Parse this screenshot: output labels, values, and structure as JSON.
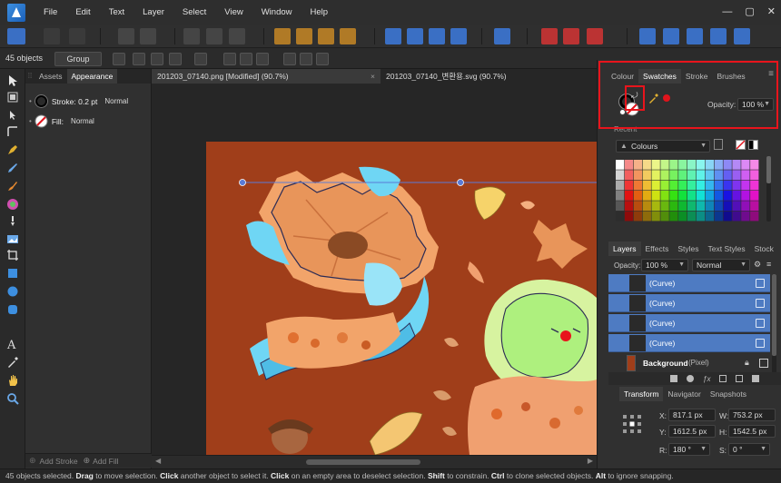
{
  "menu": {
    "items": [
      "File",
      "Edit",
      "Text",
      "Layer",
      "Select",
      "View",
      "Window",
      "Help"
    ],
    "win_min": "—",
    "win_max": "▢",
    "win_close": "✕"
  },
  "context": {
    "object_count": "45 objects",
    "group_label": "Group"
  },
  "appearance": {
    "tabs": [
      "Assets",
      "Appearance"
    ],
    "stroke_label": "Stroke: 0.2 pt",
    "stroke_blend": "Normal",
    "fill_label": "Fill:",
    "fill_blend": "Normal",
    "add_stroke": "Add Stroke",
    "add_fill": "Add Fill"
  },
  "documents": {
    "tabs": [
      {
        "label": "201203_07140.png [Modified] (90.7%)",
        "active": true
      },
      {
        "label": "201203_07140_변환용.svg (90.7%)",
        "active": false
      }
    ],
    "close": "×"
  },
  "colour_panel": {
    "tabs": [
      "Colour",
      "Swatches",
      "Stroke",
      "Brushes"
    ],
    "active_tab": "Swatches",
    "opacity_label": "Opacity:",
    "opacity_value": "100 %",
    "recent_label": "Recent",
    "palette_name": "Colours"
  },
  "layers_panel": {
    "tabs": [
      "Layers",
      "Effects",
      "Styles",
      "Text Styles",
      "Stock"
    ],
    "opacity_label": "Opacity:",
    "opacity_value": "100 %",
    "blend_mode": "Normal",
    "rows": [
      {
        "name": "(Curve)"
      },
      {
        "name": "(Curve)"
      },
      {
        "name": "(Curve)"
      },
      {
        "name": "(Curve)"
      }
    ],
    "background_name": "Background",
    "background_kind": "(Pixel)"
  },
  "transform_panel": {
    "tabs": [
      "Transform",
      "Navigator",
      "Snapshots"
    ],
    "x_label": "X:",
    "x_value": "817.1 px",
    "y_label": "Y:",
    "y_value": "1612.5 px",
    "w_label": "W:",
    "w_value": "753.2 px",
    "h_label": "H:",
    "h_value": "1542.5 px",
    "r_label": "R:",
    "r_value": "180 °",
    "s_label": "S:",
    "s_value": "0 °"
  },
  "status": {
    "p1": "45 objects selected. ",
    "k1": "Drag",
    "p2": " to move selection. ",
    "k2": "Click",
    "p3": " another object to select it. ",
    "k3": "Click",
    "p4": " on an empty area to deselect selection. ",
    "k4": "Shift",
    "p5": " to constrain. ",
    "k5": "Ctrl",
    "p6": " to clone selected objects. ",
    "k6": "Alt",
    "p7": " to ignore snapping."
  },
  "colors": {
    "artboard_bg": "#a03e1a",
    "selection_blue": "#4e7bc2",
    "highlight_red": "#e8141c",
    "fill_none_red": "#e0141c"
  }
}
